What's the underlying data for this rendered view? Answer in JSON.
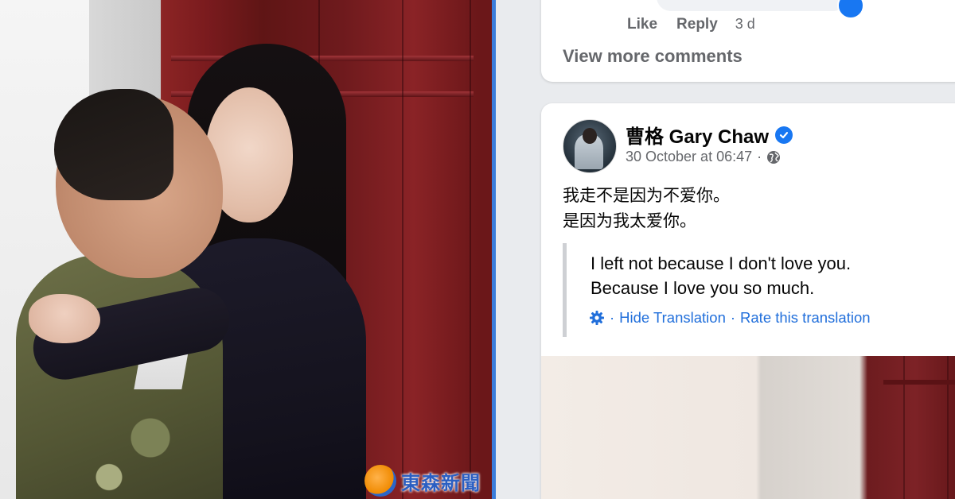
{
  "photo": {
    "watermark_text": "東森新聞"
  },
  "comment": {
    "actions": {
      "like_label": "Like",
      "reply_label": "Reply",
      "age": "3 d"
    },
    "view_more_label": "View more comments"
  },
  "post": {
    "author": "曹格 Gary Chaw",
    "verified": true,
    "timestamp": "30 October at 06:47",
    "meta_separator": "·",
    "audience_icon": "globe-icon",
    "text_lines": [
      "我走不是因为不爱你。",
      "是因为我太爱你。"
    ],
    "translation": {
      "lines": [
        "I left not because I don't love you.",
        "Because I love you so much."
      ],
      "settings_icon": "gear-icon",
      "separator": "·",
      "hide_label": "Hide Translation",
      "rate_label": "Rate this translation"
    }
  },
  "colors": {
    "facebook_blue": "#1877f2",
    "link_blue": "#216fdb",
    "secondary_text": "#65676b",
    "panel_bg": "#e9ebee",
    "divider": "#3b7ddb"
  }
}
